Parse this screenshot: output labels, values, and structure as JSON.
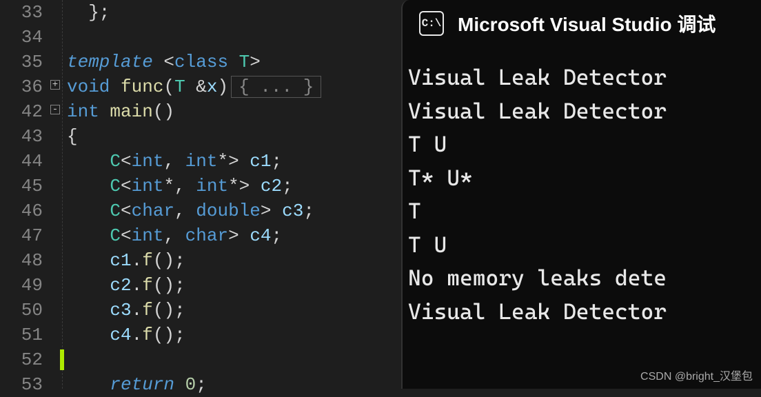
{
  "editor": {
    "lines": [
      {
        "num": "33",
        "fold": "",
        "html": "  };"
      },
      {
        "num": "34",
        "fold": "",
        "html": ""
      },
      {
        "num": "35",
        "fold": "",
        "html": "<span class='kw'>template</span> &lt;<span class='kw2'>class</span> <span class='type'>T</span>&gt;"
      },
      {
        "num": "36",
        "fold": "+",
        "html": "<span class='kw2'>void</span> <span class='fn'>func</span>(<span class='type'>T</span> &amp;<span class='var'>x</span>)<span class='collapsed'>{ ... }</span>"
      },
      {
        "num": "42",
        "fold": "-",
        "html": "<span class='kw2'>int</span> <span class='fn'>main</span>()"
      },
      {
        "num": "43",
        "fold": "",
        "html": "{"
      },
      {
        "num": "44",
        "fold": "",
        "html": "    <span class='type'>C</span>&lt;<span class='kw2'>int</span>, <span class='kw2'>int</span>*&gt; <span class='var'>c1</span>;"
      },
      {
        "num": "45",
        "fold": "",
        "html": "    <span class='type'>C</span>&lt;<span class='kw2'>int</span>*, <span class='kw2'>int</span>*&gt; <span class='var'>c2</span>;"
      },
      {
        "num": "46",
        "fold": "",
        "html": "    <span class='type'>C</span>&lt;<span class='kw2'>char</span>, <span class='kw2'>double</span>&gt; <span class='var'>c3</span>;"
      },
      {
        "num": "47",
        "fold": "",
        "html": "    <span class='type'>C</span>&lt;<span class='kw2'>int</span>, <span class='kw2'>char</span>&gt; <span class='var'>c4</span>;"
      },
      {
        "num": "48",
        "fold": "",
        "html": "    <span class='var'>c1</span>.<span class='fn'>f</span>();"
      },
      {
        "num": "49",
        "fold": "",
        "html": "    <span class='var'>c2</span>.<span class='fn'>f</span>();"
      },
      {
        "num": "50",
        "fold": "",
        "html": "    <span class='var'>c3</span>.<span class='fn'>f</span>();"
      },
      {
        "num": "51",
        "fold": "",
        "html": "    <span class='var'>c4</span>.<span class='fn'>f</span>();"
      },
      {
        "num": "52",
        "fold": "",
        "html": "<span class='cursor-mark'></span>"
      },
      {
        "num": "53",
        "fold": "",
        "html": "    <span class='kw'>return</span> <span class='num'>0</span>;"
      }
    ]
  },
  "terminal": {
    "icon_text": "C:\\",
    "title": "Microsoft Visual Studio 调试",
    "output": [
      "Visual Leak Detector",
      "Visual Leak Detector",
      "T U",
      "T* U*",
      "T",
      "T U",
      "No memory leaks dete",
      "Visual Leak Detector"
    ]
  },
  "watermark": "CSDN @bright_汉堡包"
}
